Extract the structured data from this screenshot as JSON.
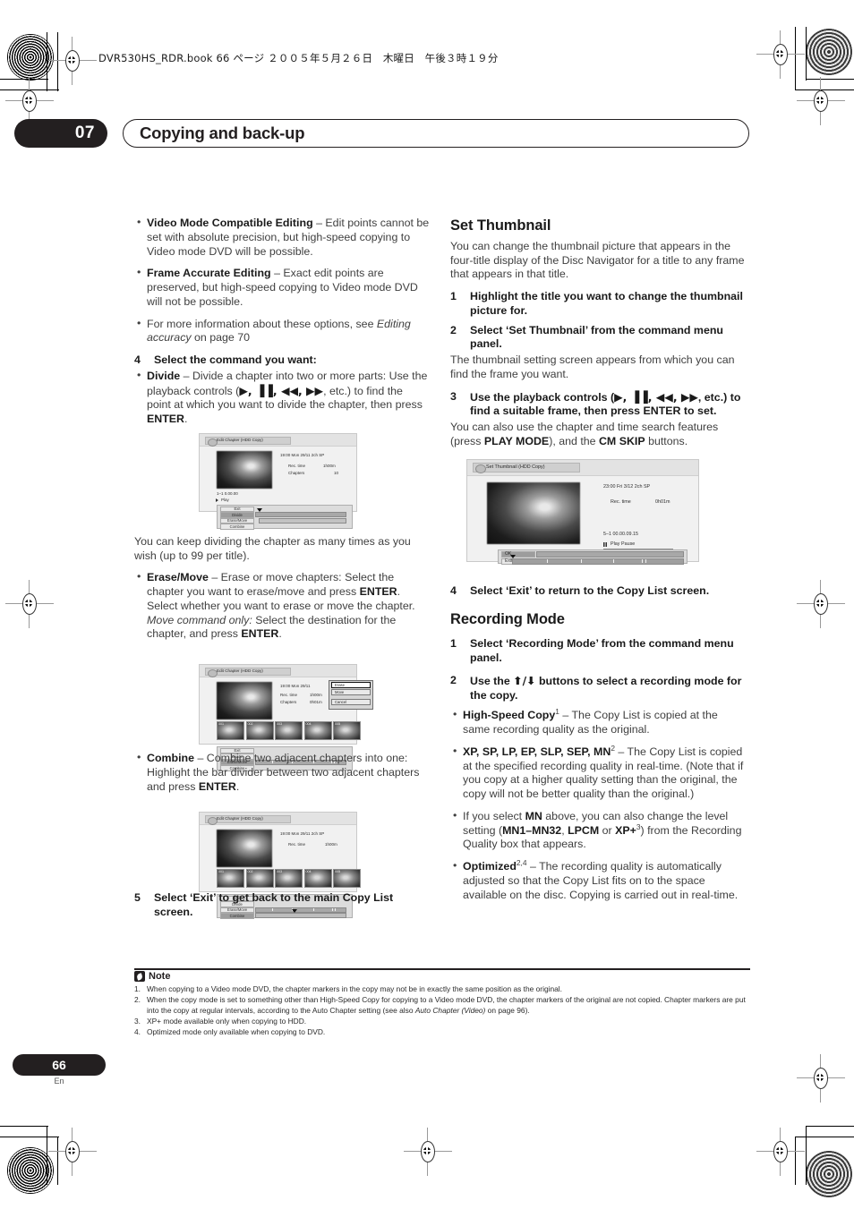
{
  "print_marks": {
    "file_meta": "DVR530HS_RDR.book   66 ページ   ２００５年５月２６日　木曜日　午後３時１９分"
  },
  "header": {
    "chapter_number": "07",
    "chapter_title": "Copying and back-up"
  },
  "left_column": {
    "bullets_top": [
      {
        "term": "Video Mode Compatible Editing",
        "dash": " – ",
        "text": "Edit points cannot be set with absolute precision, but high-speed copying to Video mode DVD will be possible."
      },
      {
        "term": "Frame Accurate Editing",
        "dash": " – ",
        "text": "Exact edit points are preserved, but high-speed copying to Video mode DVD will not be possible."
      }
    ],
    "bullet_more_info_pre": "For more information about these options, see ",
    "bullet_more_info_italic": "Editing accuracy",
    "bullet_more_info_post": " on page 70",
    "step4_num": "4",
    "step4_title": "Select the command you want:",
    "divide_term": "Divide",
    "divide_text_a": " – Divide a chapter into two or more parts: Use the playback controls (",
    "divide_controls": "▶, ▐▐, ◀◀, ▶▶",
    "divide_text_b": ", etc.) to find the point at which you want to divide the chapter, then press ",
    "divide_enter": "ENTER",
    "divide_text_c": ".",
    "divide_note": "You can keep dividing the chapter as many times as you wish (up to 99 per title).",
    "erase_term": "Erase/Move",
    "erase_text_a": " – Erase or move chapters: Select the chapter you want to erase/move and press ",
    "erase_enter1": "ENTER",
    "erase_text_b": ". Select whether you want to erase or move the chapter.",
    "erase_italic": "Move command only:",
    "erase_text_c": " Select the destination for the chapter, and press ",
    "erase_enter2": "ENTER",
    "erase_text_d": ".",
    "combine_term": "Combine",
    "combine_text_a": " – Combine two adjacent chapters into one: Highlight the bar divider between two adjacent chapters and press ",
    "combine_enter": "ENTER",
    "combine_text_b": ".",
    "step5_num": "5",
    "step5_title": "Select ‘Exit’ to get back to the main Copy List screen."
  },
  "right_column": {
    "set_thumbnail_heading": "Set Thumbnail",
    "set_thumbnail_intro": "You can change the thumbnail picture that appears in the four-title display of the Disc Navigator for a title to any frame that appears in that title.",
    "st_step1_num": "1",
    "st_step1_text": "Highlight the title you want to change the thumbnail picture for.",
    "st_step2_num": "2",
    "st_step2_text": "Select ‘Set Thumbnail’ from the command menu panel.",
    "st_step2_body": "The thumbnail setting screen appears from which you can find the frame you want.",
    "st_step3_num": "3",
    "st_step3_text_a": "Use the playback controls (",
    "st_step3_controls": "▶, ▐▐, ◀◀, ▶▶",
    "st_step3_text_b": ", etc.) to find a suitable frame, then press ENTER to set.",
    "st_step3_body_a": "You can also use the chapter and time search features (press ",
    "st_step3_playmode": "PLAY MODE",
    "st_step3_body_b": "), and the ",
    "st_step3_cmskip": "CM SKIP",
    "st_step3_body_c": " buttons.",
    "st_step4_num": "4",
    "st_step4_text": "Select ‘Exit’ to return to the Copy List screen.",
    "recording_mode_heading": "Recording Mode",
    "rm_step1_num": "1",
    "rm_step1_text": "Select ‘Recording Mode’ from the command menu panel.",
    "rm_step2_num": "2",
    "rm_step2_text_a": "Use the ",
    "rm_step2_arrows": "⬆/⬇",
    "rm_step2_text_b": " buttons to select a recording mode for the copy.",
    "hs_term": "High-Speed Copy",
    "hs_sup": "1",
    "hs_text": " – The Copy List is copied at the same recording quality as the original.",
    "modes_term": "XP, SP, LP, EP, SLP, SEP, MN",
    "modes_sup": "2",
    "modes_text": " – The Copy List is copied at the specified recording quality in real-time. (Note that if you copy at a higher quality setting than the original, the copy will not be better quality than the original.)",
    "mn_text_a": "If you select ",
    "mn_bold1": "MN",
    "mn_text_b": " above, you can also change the level setting (",
    "mn_bold2": "MN1–MN32",
    "mn_text_c": ", ",
    "mn_bold3": "LPCM",
    "mn_text_d": " or ",
    "mn_bold4": "XP+",
    "mn_sup": "3",
    "mn_text_e": ") from the Recording Quality box that appears.",
    "opt_term": "Optimized",
    "opt_sup": "2,4",
    "opt_text": " – The recording quality is automatically adjusted so that the Copy List fits on to the space available on the disc. Copying is carried out in real-time."
  },
  "screenshots": {
    "divide": {
      "title": "Edit Chapter  (HDD Copy)",
      "meta_line1": "19:00 Mon 29/11   2ch   SP",
      "meta_rec_label": "Rec. time",
      "meta_rec_value": "1h00m",
      "meta_chap_label": "Chapters",
      "meta_chap_value": "10",
      "timecode": "1–1      0.00.00",
      "play_label": "Play",
      "menu": [
        "Exit",
        "Divide",
        "Erase/Move",
        "Combine"
      ],
      "selected": "Divide"
    },
    "erase_move": {
      "title": "Edit Chapter  (HDD Copy)",
      "meta_line1": "19:00 Mon 29/11",
      "meta_rec_label": "Rec. time",
      "meta_rec_value": "1h00m",
      "meta_chap_label": "Chapters",
      "meta_chap_value": "0h01m",
      "popup": [
        "Erase",
        "Move",
        "Cancel"
      ],
      "popup_selected": "Erase",
      "thumbs": [
        "001",
        "002",
        "003",
        "004",
        "005"
      ],
      "menu": [
        "Exit",
        "Divide",
        "Erase/Move",
        "Combine"
      ],
      "selected": "Erase/Move"
    },
    "combine": {
      "title": "Edit Chapter  (HDD Copy)",
      "meta_line1": "19:00 Mon 29/11   2ch   SP",
      "meta_rec_label": "Rec. time",
      "meta_rec_value": "1h00m",
      "thumbs": [
        "001",
        "002",
        "003",
        "004",
        "005"
      ],
      "menu": [
        "Exit",
        "Divide",
        "Erase/Move",
        "Combine"
      ],
      "selected": "Combine"
    },
    "set_thumbnail": {
      "title": "Set Thumbnail  (HDD Copy)",
      "meta_line1": "23:00 Fri 3/12   2ch   SP",
      "meta_rec_label": "Rec. time",
      "meta_rec_value": "0h01m",
      "chapter_time": "5–1     00.00.09.15",
      "play_state": "Play Pause",
      "menu": [
        "OK",
        "Exit"
      ],
      "selected": "OK"
    }
  },
  "notes": {
    "heading": "Note",
    "items": [
      {
        "n": "1.",
        "text": "When copying to a Video mode DVD, the chapter markers in the copy may not be in exactly the same position as the original."
      },
      {
        "n": "2.",
        "text": "When the copy mode is set to something other than High-Speed Copy for copying to a Video mode DVD, the chapter markers of the original are not copied. Chapter markers are put into the copy at regular intervals, according to the Auto Chapter setting (see also ",
        "italic": "Auto Chapter (Video)",
        "text2": " on page 96)."
      },
      {
        "n": "3.",
        "text": "XP+ mode available only when copying to HDD."
      },
      {
        "n": "4.",
        "text": "Optimized mode only available when copying to DVD."
      }
    ]
  },
  "footer": {
    "page_number": "66",
    "language": "En"
  }
}
